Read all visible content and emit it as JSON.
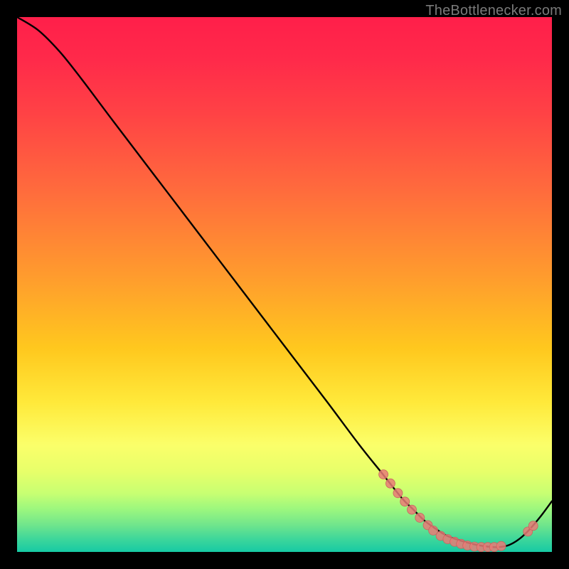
{
  "attribution": "TheBottlenecker.com",
  "colors": {
    "bg": "#000000",
    "curve": "#000000",
    "marker_fill": "#e97b77",
    "marker_stroke": "#c96560",
    "gradient_top": "#ff1f4a",
    "gradient_bottom": "#17caa4"
  },
  "chart_data": {
    "type": "line",
    "title": "",
    "xlabel": "",
    "ylabel": "",
    "xlim": [
      0,
      100
    ],
    "ylim": [
      0,
      100
    ],
    "x": [
      0,
      4,
      8,
      12,
      18,
      26,
      34,
      42,
      50,
      58,
      64,
      68,
      72,
      74,
      76,
      78,
      80,
      82,
      84,
      86,
      88,
      90,
      92,
      94,
      96,
      98,
      100
    ],
    "values": [
      100,
      97.5,
      93.5,
      88.5,
      80.5,
      70,
      59.5,
      49,
      38.5,
      28,
      20,
      15,
      10,
      8,
      6,
      4.5,
      3.2,
      2.4,
      1.8,
      1.3,
      1.0,
      0.9,
      1.3,
      2.5,
      4.4,
      6.8,
      9.5
    ],
    "marker_points": [
      {
        "x": 68.5,
        "y": 14.5
      },
      {
        "x": 69.8,
        "y": 12.8
      },
      {
        "x": 71.2,
        "y": 11.0
      },
      {
        "x": 72.5,
        "y": 9.4
      },
      {
        "x": 73.8,
        "y": 7.9
      },
      {
        "x": 75.3,
        "y": 6.4
      },
      {
        "x": 76.8,
        "y": 5.0
      },
      {
        "x": 77.8,
        "y": 4.0
      },
      {
        "x": 79.2,
        "y": 3.0
      },
      {
        "x": 80.5,
        "y": 2.4
      },
      {
        "x": 81.8,
        "y": 1.9
      },
      {
        "x": 83.0,
        "y": 1.5
      },
      {
        "x": 84.2,
        "y": 1.2
      },
      {
        "x": 85.5,
        "y": 1.0
      },
      {
        "x": 86.8,
        "y": 0.9
      },
      {
        "x": 88.0,
        "y": 0.9
      },
      {
        "x": 89.2,
        "y": 0.9
      },
      {
        "x": 90.5,
        "y": 1.1
      },
      {
        "x": 95.5,
        "y": 3.8
      },
      {
        "x": 96.5,
        "y": 4.9
      }
    ]
  }
}
